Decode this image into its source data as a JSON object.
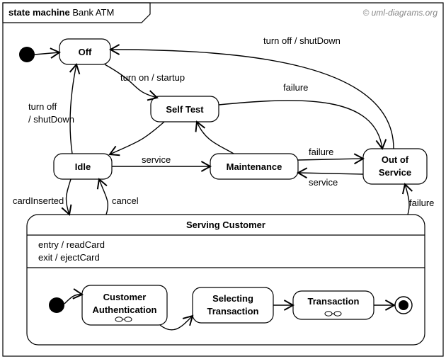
{
  "frame": {
    "kind": "state machine",
    "title": "Bank ATM"
  },
  "copyright": "© uml-diagrams.org",
  "states": {
    "off": "Off",
    "selfTest": "Self Test",
    "idle": "Idle",
    "maintenance": "Maintenance",
    "outOfService": "Out of\nService"
  },
  "serving": {
    "title": "Serving Customer",
    "entry": "entry / readCard",
    "exit": "exit / ejectCard",
    "substates": {
      "auth": "Customer\nAuthentication",
      "select": "Selecting\nTransaction",
      "trans": "Transaction"
    }
  },
  "transitions": {
    "initialToOff": "",
    "offToSelfTest": "turn on / startup",
    "outToOff": "turn off / shutDown",
    "idleToOff": "turn off\n/ shutDown",
    "selfToOut_failure": "failure",
    "selfToIdle": "",
    "idleToMaint": "service",
    "maintToSelf": "",
    "maintToOut_failure": "failure",
    "outToMaint_service": "service",
    "idleToServing": "cardInserted",
    "servingToIdle_cancel": "cancel",
    "servingToOut_failure": "failure"
  }
}
